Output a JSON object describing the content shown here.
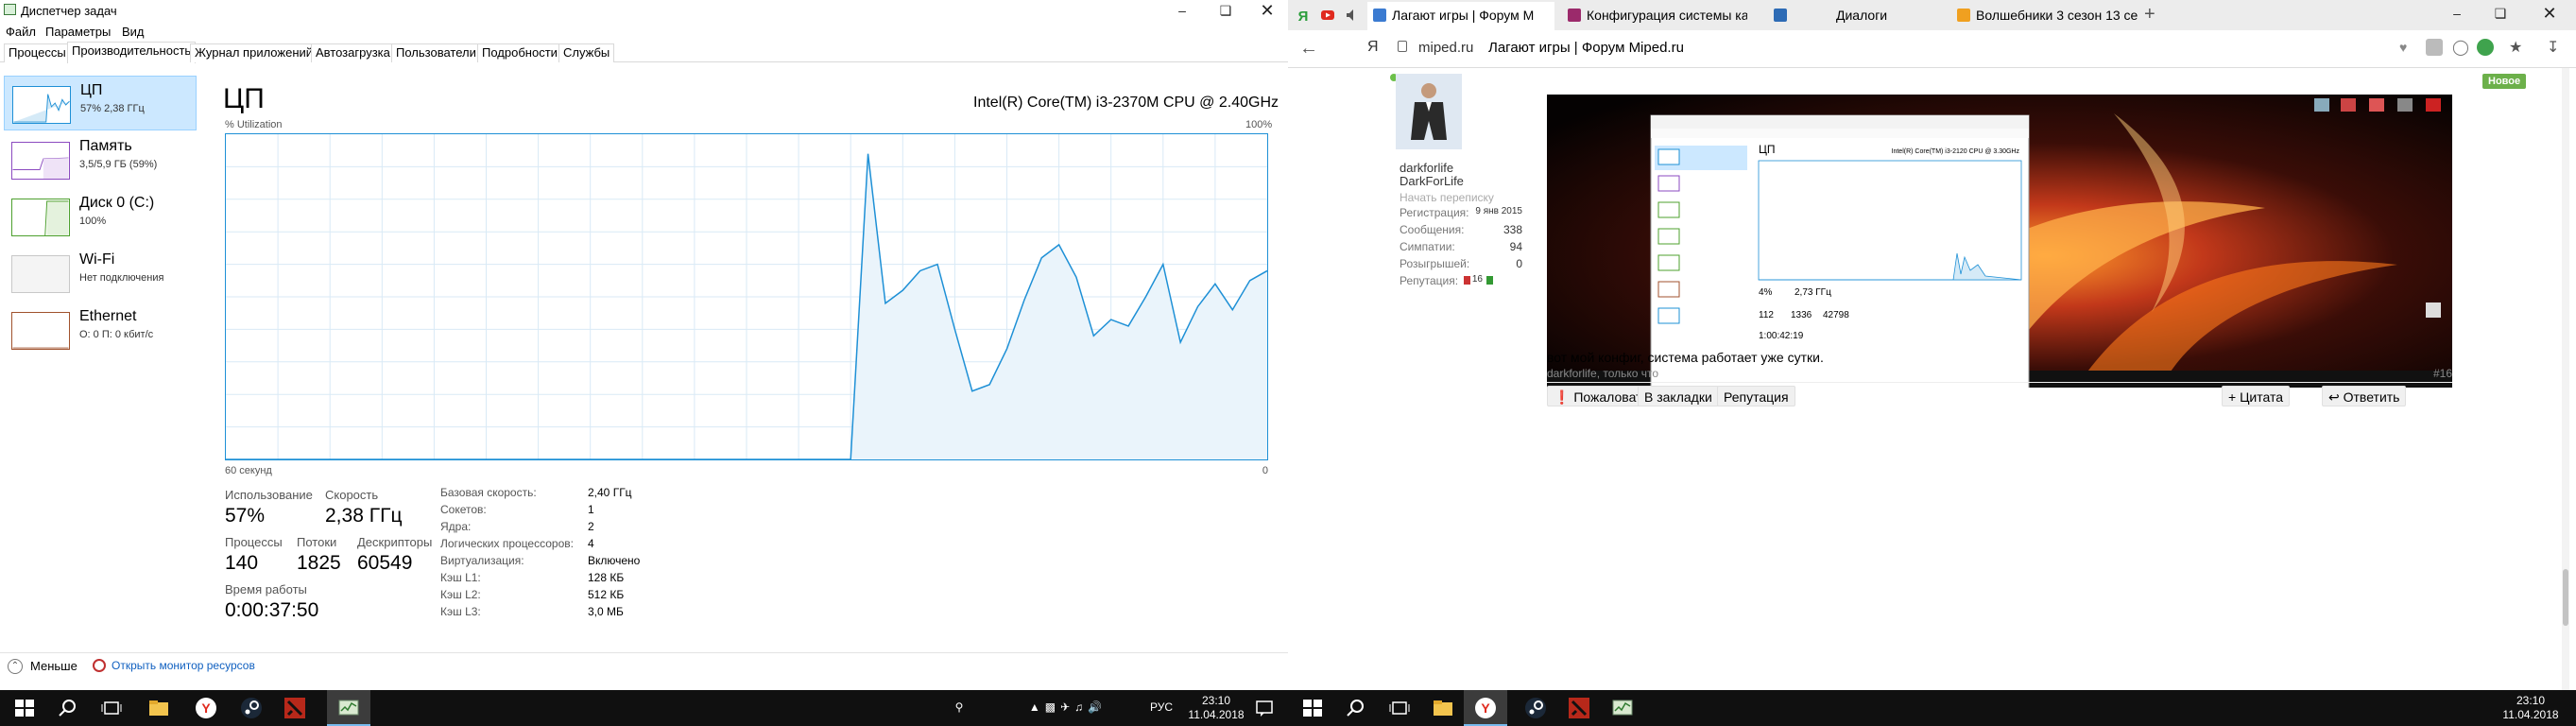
{
  "task_manager": {
    "title": "Диспетчер задач",
    "menu": [
      "Файл",
      "Параметры",
      "Вид"
    ],
    "tabs": [
      "Процессы",
      "Производительность",
      "Журнал приложений",
      "Автозагрузка",
      "Пользователи",
      "Подробности",
      "Службы"
    ],
    "active_tab": 1,
    "sidebar": [
      {
        "name": "ЦП",
        "sub": "57% 2,38 ГГц"
      },
      {
        "name": "Память",
        "sub": "3,5/5,9 ГБ (59%)"
      },
      {
        "name": "Диск 0 (C:)",
        "sub": "100%"
      },
      {
        "name": "Wi-Fi",
        "sub": "Нет подключения"
      },
      {
        "name": "Ethernet",
        "sub": "О: 0 П: 0 кбит/с"
      }
    ],
    "cpu_title": "ЦП",
    "cpu_model": "Intel(R) Core(TM) i3-2370M CPU @ 2.40GHz",
    "graph_label_top": "% Utilization",
    "graph_label_max": "100%",
    "graph_label_time": "60 секунд",
    "graph_label_min": "0",
    "stats": {
      "usage_label": "Использование",
      "usage": "57%",
      "speed_label": "Скорость",
      "speed": "2,38 ГГц",
      "processes_label": "Процессы",
      "processes": "140",
      "threads_label": "Потоки",
      "threads": "1825",
      "handles_label": "Дескрипторы",
      "handles": "60549",
      "uptime_label": "Время работы",
      "uptime": "0:00:37:50"
    },
    "details": [
      {
        "k": "Базовая скорость:",
        "v": "2,40 ГГц"
      },
      {
        "k": "Сокетов:",
        "v": "1"
      },
      {
        "k": "Ядра:",
        "v": "2"
      },
      {
        "k": "Логических процессоров:",
        "v": "4"
      },
      {
        "k": "Виртуализация:",
        "v": "Включено"
      },
      {
        "k": "Кэш L1:",
        "v": "128 КБ"
      },
      {
        "k": "Кэш L2:",
        "v": "512 КБ"
      },
      {
        "k": "Кэш L3:",
        "v": "3,0 МБ"
      }
    ],
    "fewer_details": "Меньше",
    "open_resource_monitor": "Открыть монитор ресурсов",
    "cpu_graph": {
      "type": "area",
      "xlim": [
        0,
        60
      ],
      "ylim": [
        0,
        100
      ],
      "series_color": "#1e90d6",
      "fill_color": "#eaf4fb",
      "y": [
        0,
        0,
        0,
        0,
        0,
        0,
        0,
        0,
        0,
        0,
        0,
        0,
        0,
        0,
        0,
        0,
        0,
        0,
        0,
        0,
        0,
        0,
        0,
        0,
        0,
        0,
        0,
        0,
        0,
        0,
        0,
        0,
        0,
        0,
        0,
        0,
        0,
        94,
        48,
        52,
        58,
        60,
        40,
        21,
        23,
        34,
        49,
        62,
        66,
        56,
        38,
        43,
        41,
        50,
        60,
        36,
        47,
        54,
        46,
        55,
        58
      ]
    }
  },
  "browser": {
    "tabs": [
      {
        "title": "Лагают игры | Форум M",
        "color": "#ffffff",
        "fav": "#3b7bd1"
      },
      {
        "title": "Конфигурация системы как",
        "color": "#ececec",
        "fav": "#9b2a6b"
      },
      {
        "title": "Диалоги",
        "color": "#ececec",
        "fav": "#2d6bb5"
      },
      {
        "title": "Волшебники 3 сезон 13 се",
        "color": "#ececec",
        "fav": "#f0a020"
      }
    ],
    "address_domain": "miped.ru",
    "address_title": "Лагают игры | Форум Miped.ru",
    "new_badge": "Новое",
    "profile": {
      "username": "darkforlife",
      "nickname": "DarkForLife",
      "start_chat": "Начать переписку",
      "rows": [
        {
          "k": "Регистрация:",
          "v": "9 янв 2015"
        },
        {
          "k": "Сообщения:",
          "v": "338"
        },
        {
          "k": "Симпатии:",
          "v": "94"
        },
        {
          "k": "Розыгрышей:",
          "v": "0"
        },
        {
          "k": "Репутация:",
          "v": "16"
        }
      ]
    },
    "post_text": "вот мой конфиг, система работает уже сутки.",
    "post_author": "darkforlife, только что",
    "post_number": "#16",
    "actions": [
      "Пожаловаться",
      "В закладки",
      "Репутация"
    ],
    "quote": "+ Цитата",
    "reply": "Ответить"
  },
  "inner_screenshot": {
    "title": "ЦП",
    "model": "Intel(R) Core(TM) i3-2120 CPU @ 3.30GHz",
    "usage": "4%",
    "speed": "2,73 ГГц",
    "processes": "112",
    "threads": "1336",
    "handles": "42798",
    "uptime": "1:00:42:19"
  },
  "taskbar": {
    "left_time": "23:10",
    "left_date": "11.04.2018",
    "lang": "РУС",
    "right_time": "23:10",
    "right_date": "11.04.2018"
  },
  "colors": {
    "accent": "#1e90d6",
    "selected": "#cce8ff",
    "memory": "#8b4ac0",
    "disk": "#4da02e",
    "ethernet": "#a0522d",
    "taskbar": "#101010"
  }
}
